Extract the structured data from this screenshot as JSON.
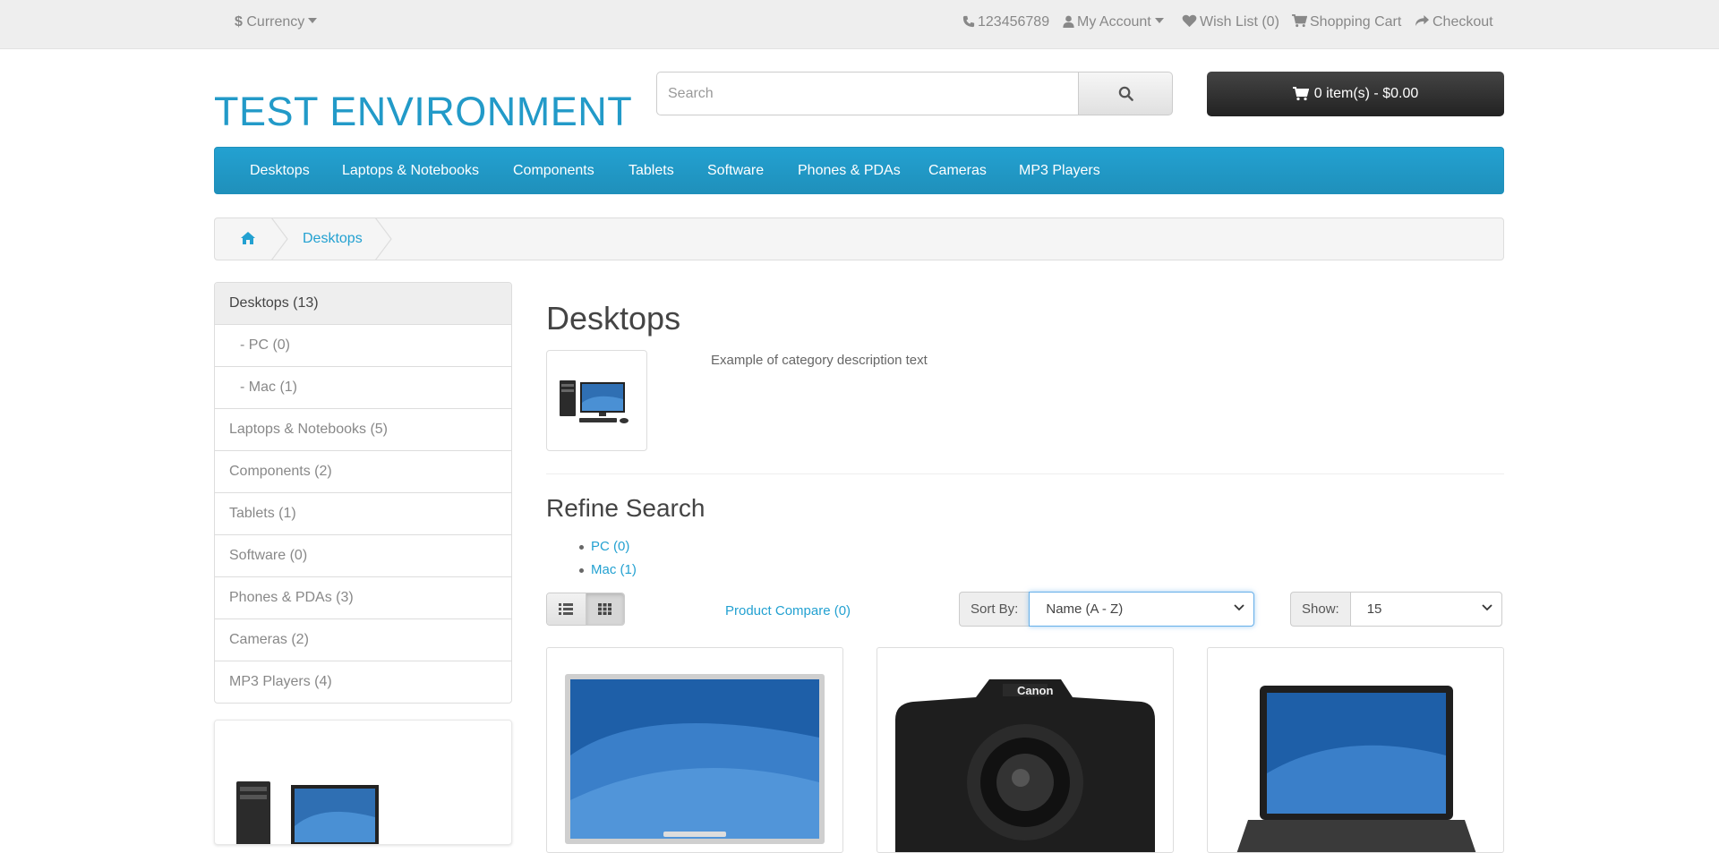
{
  "topbar": {
    "currency": "Currency",
    "phone": "123456789",
    "my_account": "My Account",
    "wish_list": "Wish List (0)",
    "shopping_cart": "Shopping Cart",
    "checkout": "Checkout"
  },
  "header": {
    "logo": "TEST ENVIRONMENT",
    "search_placeholder": "Search",
    "cart_label": "0 item(s) - $0.00"
  },
  "nav": {
    "items": [
      "Desktops",
      "Laptops & Notebooks",
      "Components",
      "Tablets",
      "Software",
      "Phones & PDAs",
      "Cameras",
      "MP3 Players"
    ]
  },
  "breadcrumb": {
    "current": "Desktops"
  },
  "sidebar": {
    "items": [
      {
        "label": "Desktops (13)"
      },
      {
        "label": "- PC (0)"
      },
      {
        "label": "- Mac (1)"
      },
      {
        "label": "Laptops & Notebooks (5)"
      },
      {
        "label": "Components (2)"
      },
      {
        "label": "Tablets (1)"
      },
      {
        "label": "Software (0)"
      },
      {
        "label": "Phones & PDAs (3)"
      },
      {
        "label": "Cameras (2)"
      },
      {
        "label": "MP3 Players (4)"
      }
    ]
  },
  "main": {
    "title": "Desktops",
    "description": "Example of category description text",
    "refine_title": "Refine Search",
    "refine_items": [
      "PC (0)",
      "Mac (1)"
    ],
    "compare": "Product Compare (0)",
    "sort_label": "Sort By:",
    "sort_value": "Name (A - Z)",
    "show_label": "Show:",
    "show_value": "15"
  },
  "colors": {
    "accent": "#229ac8",
    "nav_bg": "#229ac8",
    "cart_bg": "#303030"
  }
}
